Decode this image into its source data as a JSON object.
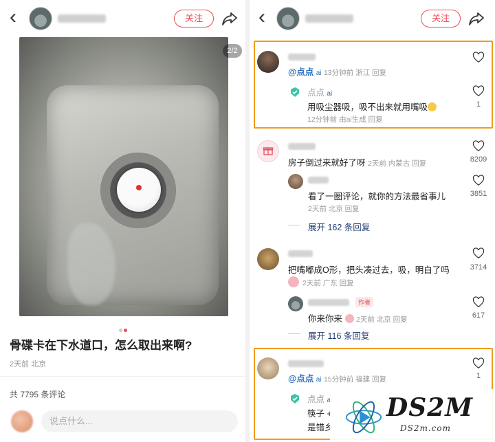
{
  "left": {
    "header": {
      "back_glyph": "‹",
      "follow_label": "关注"
    },
    "post": {
      "page_indicator": "2/2",
      "title": "骨碟卡在下水道口，怎么取出来啊?",
      "meta": "2天前 北京",
      "comment_count": "共 7795 条评论",
      "input_placeholder": "说点什么..."
    }
  },
  "right": {
    "header": {
      "back_glyph": "‹",
      "follow_label": "关注"
    },
    "comments": [
      {
        "mention": "@点点",
        "ai": "ai",
        "meta": "13分钟前 浙江 回复",
        "reply": {
          "name": "点点",
          "ai": "ai",
          "text": "用吸尘器吸，吸不出来就用嘴吸",
          "meta": "12分钟前 由ai生成 回复",
          "likes": "1"
        }
      },
      {
        "text": "房子倒过来就好了呀",
        "meta": "2天前 内蒙古 回复",
        "likes": "8209",
        "reply": {
          "text": "看了一圈评论，就你的方法最省事儿",
          "meta": "2天前 北京 回复",
          "likes": "3851"
        },
        "expand": "展开 162 条回复"
      },
      {
        "text": "把嘴嘟成O形，把头凑过去，吸，明白了吗",
        "meta": "2天前 广东 回复",
        "likes": "3714",
        "reply": {
          "tag": "作者",
          "text": "你来你来",
          "meta": "2天前 北京 回复",
          "likes": "617"
        },
        "expand": "展开 116 条回复"
      },
      {
        "mention": "@点点",
        "ai": "ai",
        "meta": "15分钟前 福建 回复",
        "likes": "1",
        "reply": {
          "name": "点点",
          "ai": "ai",
          "text_line1": "筷子 +",
          "text_line2": "是错乡"
        }
      }
    ]
  },
  "watermark": {
    "big": "DS2M",
    "small": "DS2m.com"
  },
  "colors": {
    "accent": "#f04a5a",
    "highlight_border": "#f29a1d",
    "mention": "#2a6fbf"
  }
}
